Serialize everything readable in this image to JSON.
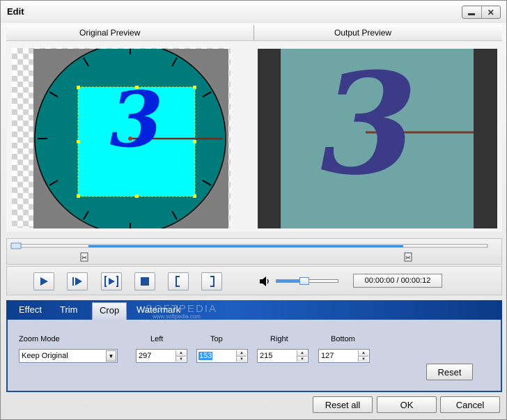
{
  "window": {
    "title": "Edit"
  },
  "preview": {
    "original_label": "Original Preview",
    "output_label": "Output Preview",
    "frame_digit": "3"
  },
  "player": {
    "time_display": "00:00:00 / 00:00:12",
    "volume_level": 0.45,
    "trim_start_fraction": 0.16,
    "trim_end_fraction": 0.85
  },
  "tabs": [
    {
      "label": "Effect"
    },
    {
      "label": "Trim"
    },
    {
      "label": "Crop"
    },
    {
      "label": "Watermark"
    }
  ],
  "active_tab": "Crop",
  "watermark_overlay": {
    "text": "SOFTPEDIA",
    "sub": "www.softpedia.com"
  },
  "crop": {
    "zoom_mode_label": "Zoom Mode",
    "zoom_mode_value": "Keep Original",
    "left_label": "Left",
    "left_value": "297",
    "top_label": "Top",
    "top_value": "153",
    "right_label": "Right",
    "right_value": "215",
    "bottom_label": "Bottom",
    "bottom_value": "127",
    "reset_label": "Reset"
  },
  "footer": {
    "reset_all_label": "Reset all",
    "ok_label": "OK",
    "cancel_label": "Cancel"
  },
  "colors": {
    "clock_face": "#007b7b",
    "crop_area": "#00ffff",
    "digit": "#0022dd",
    "output_bg": "#6fa5a5",
    "output_digit": "#3b3b88",
    "tab_bar": "#1d5ec0",
    "panel_bg": "#cdd3e3"
  }
}
